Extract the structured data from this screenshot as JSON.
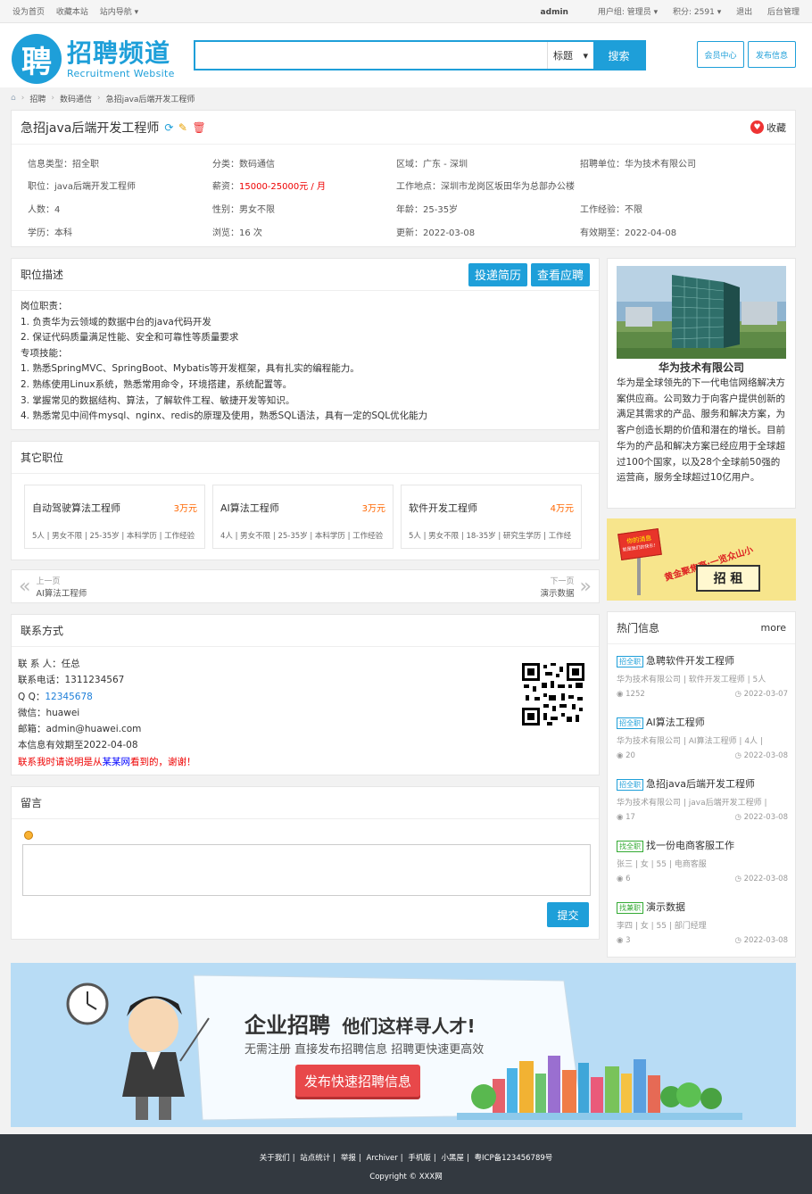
{
  "topbar": {
    "set_home": "设为首页",
    "bookmark": "收藏本站",
    "site_nav": "站内导航",
    "user": "admin",
    "group": "用户组: 管理员",
    "points": "积分: 2591",
    "logout": "退出",
    "admin_panel": "后台管理"
  },
  "logo": {
    "char": "聘",
    "title": "招聘频道",
    "subtitle": "Recruitment Website"
  },
  "search": {
    "placeholder": "",
    "select_value": "标题",
    "button": "搜索"
  },
  "header_buttons": {
    "member": "会员中心",
    "post": "发布信息"
  },
  "breadcrumb": {
    "items": [
      "招聘",
      "数码通信",
      "急招java后端开发工程师"
    ]
  },
  "job": {
    "title": "急招java后端开发工程师",
    "favorite": "收藏",
    "fields": {
      "type": "信息类型：招全职",
      "category": "分类：数码通信",
      "region": "区域：广东 - 深圳",
      "company": "招聘单位：华为技术有限公司",
      "position": "职位：java后端开发工程师",
      "salary_label": "薪资：",
      "salary_value": "15000-25000元 / 月",
      "location": "工作地点：深圳市龙岗区坂田华为总部办公楼",
      "headcount": "人数：4",
      "gender": "性别：男女不限",
      "age": "年龄：25-35岁",
      "experience": "工作经验：不限",
      "education": "学历：本科",
      "views": "浏览：16 次",
      "updated": "更新：2022-03-08",
      "valid_until": "有效期至：2022-04-08"
    }
  },
  "description": {
    "title": "职位描述",
    "apply": "投递简历",
    "view_apply": "查看应聘",
    "lines": [
      "岗位职责：",
      "1. 负责华为云领域的数据中台的java代码开发",
      "2. 保证代码质量满足性能、安全和可靠性等质量要求",
      "专项技能：",
      "1. 熟悉SpringMVC、SpringBoot、Mybatis等开发框架，具有扎实的编程能力。",
      "2. 熟练使用Linux系统，熟悉常用命令，环境搭建，系统配置等。",
      "3. 掌握常见的数据结构、算法，了解软件工程、敏捷开发等知识。",
      "4. 熟悉常见中间件mysql、nginx、redis的原理及使用，熟悉SQL语法，具有一定的SQL优化能力"
    ]
  },
  "other_jobs": {
    "title": "其它职位",
    "items": [
      {
        "name": "自动驾驶算法工程师",
        "pay": "3万元",
        "meta": "5人 | 男女不限 | 25-35岁 | 本科学历 | 工作经验"
      },
      {
        "name": "AI算法工程师",
        "pay": "3万元",
        "meta": "4人 | 男女不限 | 25-35岁 | 本科学历 | 工作经验"
      },
      {
        "name": "软件开发工程师",
        "pay": "4万元",
        "meta": "5人 | 男女不限 | 18-35岁 | 研究生学历 | 工作经"
      }
    ]
  },
  "pager": {
    "prev_label": "上一页",
    "prev_value": "AI算法工程师",
    "next_label": "下一页",
    "next_value": "演示数据"
  },
  "contact": {
    "title": "联系方式",
    "person": "联 系 人：任总",
    "phone": "联系电话：1311234567",
    "qq_label": "Q Q：",
    "qq": "12345678",
    "wechat": "微信：huawei",
    "email": "邮箱：admin@huawei.com",
    "valid": "本信息有效期至2022-04-08",
    "note_a": "联系我时请说明是从",
    "note_site": "某某网",
    "note_b": "看到的，谢谢！"
  },
  "message": {
    "title": "留言",
    "submit": "提交",
    "placeholder": ""
  },
  "company": {
    "name": "华为技术有限公司",
    "desc": "华为是全球领先的下一代电信网络解决方案供应商。公司致力于向客户提供创新的满足其需求的产品、服务和解决方案，为客户创造长期的价值和潜在的增长。目前华为的产品和解决方案已经应用于全球超过100个国家，以及28个全球前50强的运营商，服务全球超过10亿用户。"
  },
  "ad": {
    "sign_text": "你的消息",
    "sign_sub": "就是我们的快乐！",
    "slogan": "黄金聚焦亭",
    "slogan2": "一览众山小",
    "rent": "招 租"
  },
  "hot": {
    "title": "热门信息",
    "more": "more",
    "items": [
      {
        "tag": "招全职",
        "title": "急聘软件开发工程师",
        "sub": "华为技术有限公司 | 软件开发工程师 | 5人",
        "views": "1252",
        "date": "2022-03-07",
        "green": false
      },
      {
        "tag": "招全职",
        "title": "AI算法工程师",
        "sub": "华为技术有限公司 | AI算法工程师 | 4人 |",
        "views": "20",
        "date": "2022-03-08",
        "green": false
      },
      {
        "tag": "招全职",
        "title": "急招java后端开发工程师",
        "sub": "华为技术有限公司 | java后端开发工程师 |",
        "views": "17",
        "date": "2022-03-08",
        "green": false
      },
      {
        "tag": "找全职",
        "title": "找一份电商客服工作",
        "sub": "张三 | 女 | 55 | 电商客服",
        "views": "6",
        "date": "2022-03-08",
        "green": true
      },
      {
        "tag": "找兼职",
        "title": "演示数据",
        "sub": "李四 | 女 | 55 | 部门经理",
        "views": "3",
        "date": "2022-03-08",
        "green": true
      }
    ]
  },
  "banner": {
    "headline": "企业招聘",
    "headline2": "他们这样寻人才!",
    "sub": "无需注册  直接发布招聘信息  招聘更快速更高效",
    "button": "发布快速招聘信息"
  },
  "footer": {
    "links": [
      "关于我们",
      "站点统计",
      "举报",
      "Archiver",
      "手机版",
      "小黑屋",
      "粤ICP备123456789号"
    ],
    "copyright": "Copyright © XXX网"
  },
  "colors": {
    "primary": "#1e9fd9",
    "salary": "#ee0000",
    "footer_bg": "#333940"
  }
}
